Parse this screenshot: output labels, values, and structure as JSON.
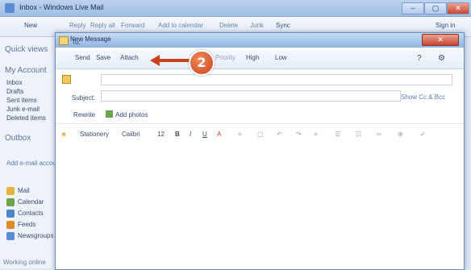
{
  "main_window": {
    "title": "Inbox - Windows Live Mail",
    "controls": [
      "–",
      "▢",
      "✕"
    ],
    "toolbar": [
      "New",
      "Reply",
      "Reply all",
      "Forward",
      "Add to calendar",
      "Delete",
      "Junk",
      "Sync",
      "Sign in"
    ]
  },
  "sidebar": {
    "quick_views_label": "Quick views",
    "account_label": "My Account",
    "folders": [
      "Inbox",
      "Drafts",
      "Sent items",
      "Junk e-mail",
      "Deleted items"
    ],
    "outbox_label": "Outbox",
    "add_account": "Add e-mail account",
    "nav": [
      {
        "label": "Mail",
        "color": "#e7b43a"
      },
      {
        "label": "Calendar",
        "color": "#6da34d"
      },
      {
        "label": "Contacts",
        "color": "#4f86c6"
      },
      {
        "label": "Feeds",
        "color": "#e08a2e"
      },
      {
        "label": "Newsgroups",
        "color": "#5b8bd1"
      }
    ],
    "footer": "Working online"
  },
  "compose": {
    "title": "New Message",
    "close": "✕",
    "toolbar": [
      "Send",
      "Save",
      "Attach",
      "Priority",
      "High",
      "Low"
    ],
    "to_label": "To:",
    "to_value": "",
    "subject_label": "Subject:",
    "subject_value": "",
    "show_cc_bcc": "Show Cc & Bcc",
    "attach_row": [
      "Rewrite",
      "Add photos"
    ],
    "format_bar": [
      "Stationery",
      "Calibri",
      "12",
      "B",
      "I",
      "U"
    ],
    "body": ""
  },
  "callout": {
    "number": "2",
    "color": "#d9552a"
  }
}
